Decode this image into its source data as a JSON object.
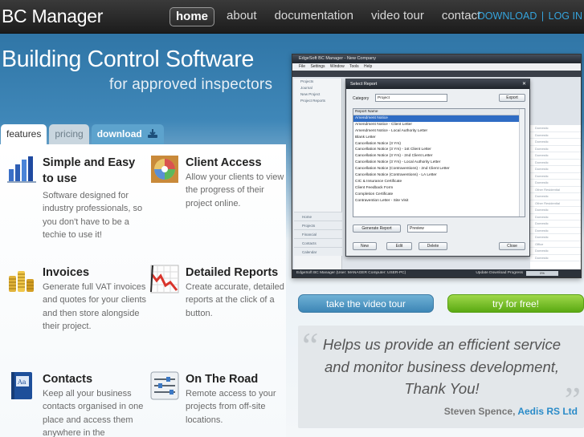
{
  "brand": "BC Manager",
  "nav": [
    {
      "label": "home",
      "active": true
    },
    {
      "label": "about"
    },
    {
      "label": "documentation"
    },
    {
      "label": "video tour"
    },
    {
      "label": "contact"
    }
  ],
  "toplinks": {
    "download": "DOWNLOAD",
    "separator": "|",
    "login": "LOG IN"
  },
  "hero": {
    "title": "Building Control Software",
    "subtitle": "for approved inspectors"
  },
  "tabs": {
    "features": "features",
    "pricing": "pricing",
    "download": "download"
  },
  "features": [
    {
      "title": "Simple and Easy to use",
      "text": "Software designed for industry professionals, so you don't have to be a techie to use it!",
      "icon": "bar-chart-icon"
    },
    {
      "title": "Client Access",
      "text": "Allow your clients to view the progress of their project online.",
      "icon": "color-wheel-icon"
    },
    {
      "title": "Invoices",
      "text": "Generate full VAT invoices and quotes for your clients and then store alongside their project.",
      "icon": "coins-icon"
    },
    {
      "title": "Detailed Reports",
      "text": "Create accurate, detailed reports at the click of a button.",
      "icon": "line-chart-icon"
    },
    {
      "title": "Contacts",
      "text": "Keep all your business contacts organised in one place and access them anywhere in the",
      "icon": "address-book-icon"
    },
    {
      "title": "On The Road",
      "text": "Remote access to your projects from off-site locations.",
      "icon": "sliders-icon"
    }
  ],
  "screenshot": {
    "window_title": "EdgeSoft BC Manager - New Company",
    "menu": "File  Settings  Window  Tools  Help",
    "sidebar_items": [
      "Projects",
      "Journal",
      "New Project",
      "Project Reports"
    ],
    "sidebar_bottom": [
      "Home",
      "Projects",
      "Financial",
      "Contacts",
      "Calendar"
    ],
    "dialog_title": "Select Report",
    "category_label": "Category",
    "category_value": "Project",
    "export_label": "Export",
    "list_header": "Report Name",
    "reports": [
      "Amendment Notice",
      "Amendment Notice - Client Letter",
      "Amendment Notice - Local Authority Letter",
      "Blank Letter",
      "Cancellation Notice (3 Yrs)",
      "Cancellation Notice (3 Yrs) - 1st Client Letter",
      "Cancellation Notice (3 Yrs) - 2nd Client Letter",
      "Cancellation Notice (3 Yrs) - Local Authority Letter",
      "Cancellation Notice (Contraventions) - 2nd Client Letter",
      "Cancellation Notice (Contraventions) - LA Letter",
      "CIC & Insurance Certificate",
      "Client Feedback Form",
      "Completion Certificate",
      "Contravention Letter - Site Visit"
    ],
    "generate_label": "Generate Report",
    "preview_value": "Preview",
    "new_label": "New",
    "edit_label": "Edit",
    "delete_label": "Delete",
    "close_label": "Close",
    "grid_rows": [
      "Domestic",
      "Domestic",
      "Domestic",
      "Domestic",
      "Domestic",
      "Domestic",
      "Domestic",
      "Domestic",
      "Domestic",
      "Other Residential",
      "Domestic",
      "Other Residential",
      "Domestic",
      "Domestic",
      "Domestic",
      "Domestic",
      "Domestic",
      "Office",
      "Domestic",
      "Domestic"
    ],
    "status": "EdgeSoft BC Manager (User: MANAGER Computer: USER-PC)",
    "status_right": "Update Download Progress",
    "progress_text": "0%"
  },
  "cta": {
    "tour": "take the video tour",
    "try": "try for free!"
  },
  "testimonial": {
    "quote": "Helps us provide an efficient service and monitor business development, Thank You!",
    "name": "Steven Spence,",
    "company": "Aedis RS Ltd"
  },
  "colors": {
    "accent_blue": "#2a8bc8",
    "green": "#6cbf1c",
    "topbar": "#2a2a2a"
  }
}
